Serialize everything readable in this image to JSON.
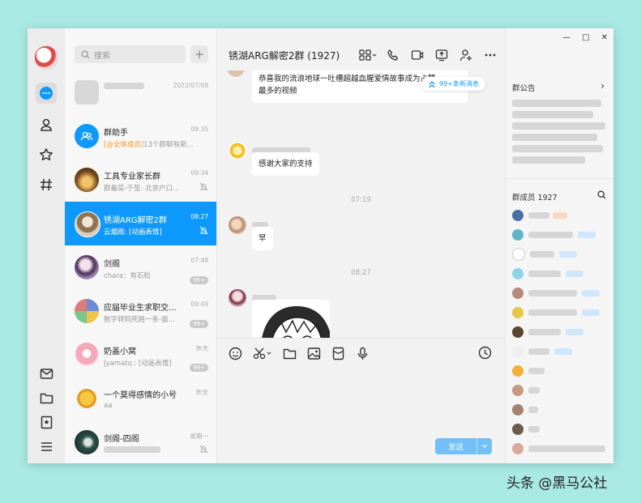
{
  "search": {
    "placeholder": "搜索"
  },
  "header": {
    "chat_title": "锈湖ARG解密2群 (1927)"
  },
  "conversations": [
    {
      "name": "",
      "preview": "",
      "time": "2022/07/08"
    },
    {
      "name": "群助手",
      "preview_highlight": "[@全体成员]",
      "preview": "13个群聊有新...",
      "time": "09:35"
    },
    {
      "name": "工具专业家长群",
      "preview": "群最菜-于笙: 北京户口...",
      "time": "09:34"
    },
    {
      "name": "锈湖ARG解密2群",
      "preview": "云烟雨: [动画表情]",
      "time": "08:27"
    },
    {
      "name": "剑阁",
      "preview": "chara：有石粒",
      "time": "07:48",
      "badge": "99+"
    },
    {
      "name": "应届毕业生求职交...",
      "preview": "数字转码死路一条-面...",
      "time": "00:49",
      "badge": "99+"
    },
    {
      "name": "奶盖小窝",
      "preview": "Jyamato.: [动画表情]",
      "time": "昨天",
      "badge": "99+"
    },
    {
      "name": "一个莫得感情的小号",
      "preview": "aa",
      "time": "昨天"
    },
    {
      "name": "剑阁-四阁",
      "preview": "",
      "time": "星期一"
    }
  ],
  "messages": {
    "first_line1": "恭喜我的流浪地球一吐槽超越血腥爱情故事成为占赞",
    "first_line2": "最多的视频",
    "new_messages": "99+条新消息",
    "thanks": "感谢大家的支持",
    "time1": "07:19",
    "morning": "早",
    "time2": "08:27"
  },
  "composer": {
    "send_label": "发送"
  },
  "side": {
    "announcement_title": "群公告",
    "members_title": "群成员 1927"
  },
  "watermark": "头条 @黑马公社",
  "colors": {
    "accent": "#0d99ff",
    "background": "#a9e9e3"
  }
}
